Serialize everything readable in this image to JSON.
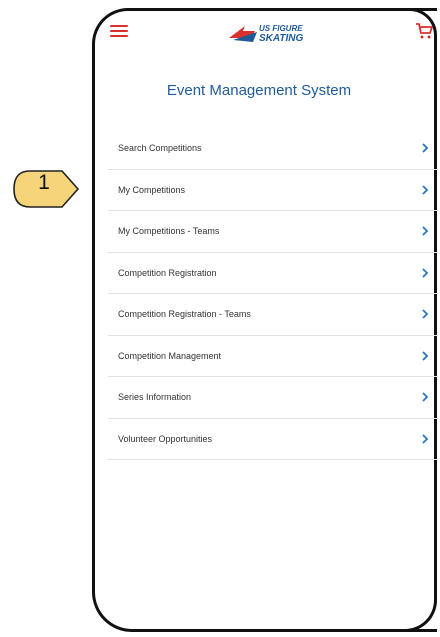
{
  "header": {
    "logo_text_line1": "US FIGURE",
    "logo_text_line2": "SKATING"
  },
  "page_title": "Event Management System",
  "menu": [
    {
      "label": "Search Competitions"
    },
    {
      "label": "My Competitions"
    },
    {
      "label": "My Competitions - Teams"
    },
    {
      "label": "Competition Registration"
    },
    {
      "label": "Competition Registration - Teams"
    },
    {
      "label": "Competition Management"
    },
    {
      "label": "Series Information"
    },
    {
      "label": "Volunteer Opportunities"
    }
  ],
  "annotation": {
    "number": "1"
  },
  "colors": {
    "accent_red": "#d9312b",
    "title_blue": "#1f5a9a",
    "chevron_blue": "#2a74c4",
    "badge_fill": "#f6d57a"
  },
  "icons": {
    "menu": "hamburger-icon",
    "cart": "cart-icon",
    "chevron": "chevron-right-icon"
  }
}
